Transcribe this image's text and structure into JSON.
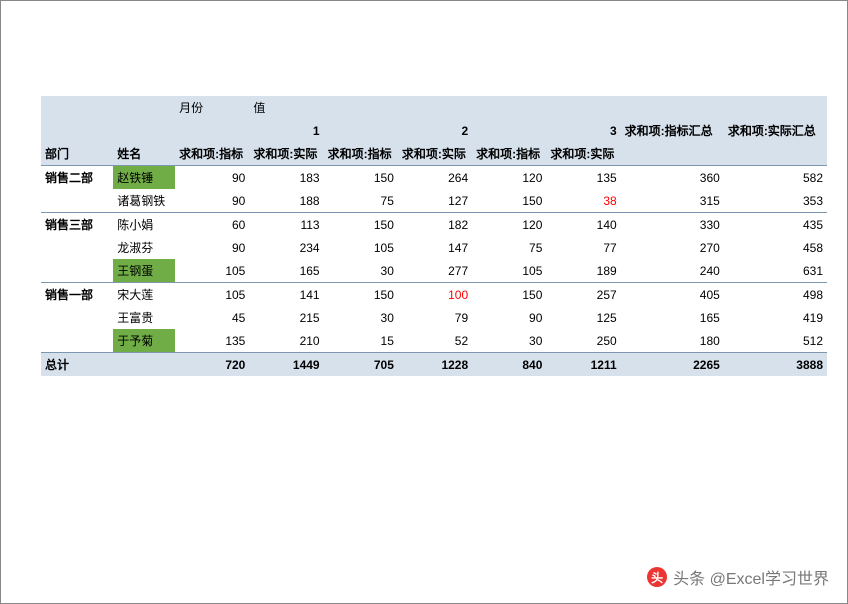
{
  "labels": {
    "month": "月份",
    "value": "值",
    "dept": "部门",
    "name": "姓名",
    "sum_target": "求和项:指标",
    "sum_actual": "求和项:实际",
    "sum_target_total": "求和项:指标汇总",
    "sum_actual_total": "求和项:实际汇总",
    "m1": "1",
    "m2": "2",
    "m3": "3",
    "grand": "总计"
  },
  "rows": [
    {
      "dept": "销售二部",
      "name": "赵铁锤",
      "green": true,
      "v": [
        90,
        183,
        150,
        264,
        120,
        135
      ],
      "sum": [
        360,
        582
      ],
      "red": []
    },
    {
      "dept": "",
      "name": "诸葛钢铁",
      "green": false,
      "v": [
        90,
        188,
        75,
        127,
        150,
        38
      ],
      "sum": [
        315,
        353
      ],
      "red": [
        5
      ]
    },
    {
      "dept": "销售三部",
      "name": "陈小娟",
      "green": false,
      "v": [
        60,
        113,
        150,
        182,
        120,
        140
      ],
      "sum": [
        330,
        435
      ],
      "red": []
    },
    {
      "dept": "",
      "name": "龙淑芬",
      "green": false,
      "v": [
        90,
        234,
        105,
        147,
        75,
        77
      ],
      "sum": [
        270,
        458
      ],
      "red": []
    },
    {
      "dept": "",
      "name": "王钢蛋",
      "green": true,
      "v": [
        105,
        165,
        30,
        277,
        105,
        189
      ],
      "sum": [
        240,
        631
      ],
      "red": []
    },
    {
      "dept": "销售一部",
      "name": "宋大莲",
      "green": false,
      "v": [
        105,
        141,
        150,
        100,
        150,
        257
      ],
      "sum": [
        405,
        498
      ],
      "red": [
        3
      ]
    },
    {
      "dept": "",
      "name": "王富贵",
      "green": false,
      "v": [
        45,
        215,
        30,
        79,
        90,
        125
      ],
      "sum": [
        165,
        419
      ],
      "red": []
    },
    {
      "dept": "",
      "name": "于予菊",
      "green": true,
      "v": [
        135,
        210,
        15,
        52,
        30,
        250
      ],
      "sum": [
        180,
        512
      ],
      "red": []
    }
  ],
  "totals": {
    "v": [
      720,
      1449,
      705,
      1228,
      840,
      1211
    ],
    "sum": [
      2265,
      3888
    ]
  },
  "watermark": "头条 @Excel学习世界"
}
